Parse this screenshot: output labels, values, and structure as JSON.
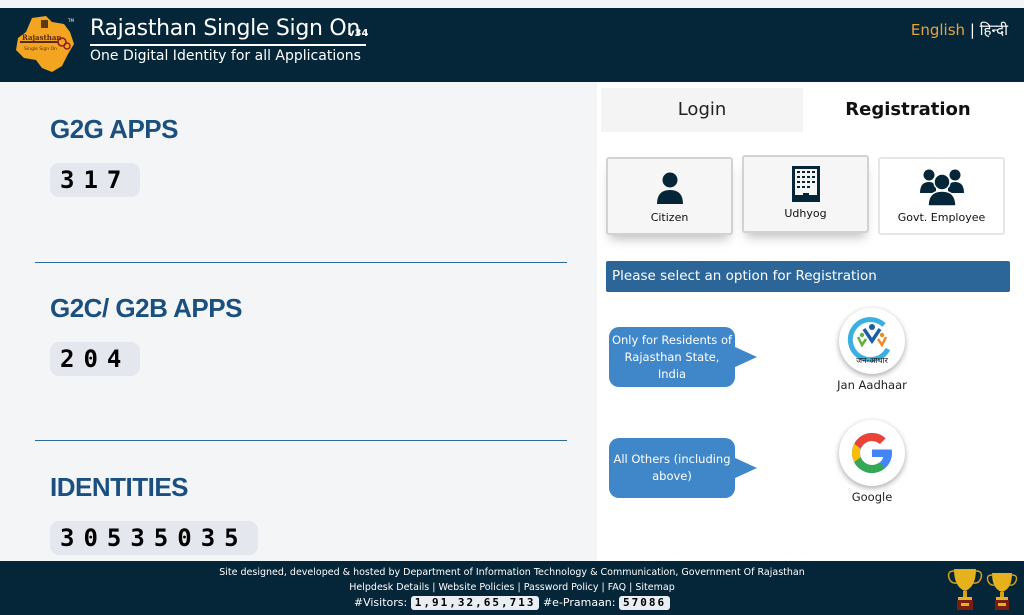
{
  "header": {
    "logo_alt": "Rajasthan Single Sign On",
    "title": "Rajasthan Single Sign On",
    "version": "v34",
    "subtitle": "One Digital Identity for all Applications",
    "lang_english": "English",
    "lang_separator": "|",
    "lang_hindi": "हिन्दी"
  },
  "stats": [
    {
      "label": "G2G APPS",
      "value": "317"
    },
    {
      "label": "G2C/ G2B APPS",
      "value": "204"
    },
    {
      "label": "IDENTITIES",
      "value": "30535035"
    }
  ],
  "tabs": {
    "login": "Login",
    "registration": "Registration",
    "active": "registration"
  },
  "registration": {
    "types": [
      {
        "label": "Citizen",
        "icon": "user-icon"
      },
      {
        "label": "Udhyog",
        "icon": "building-icon"
      },
      {
        "label": "Govt. Employee",
        "icon": "users-icon"
      }
    ],
    "banner": "Please select an option for Registration",
    "options": [
      {
        "note": "Only for Residents of Rajasthan State, India",
        "provider": "Jan Aadhaar",
        "logo_text": "जन-आधार"
      },
      {
        "note": "All Others (including above)",
        "provider": "Google"
      }
    ]
  },
  "footer": {
    "credit": "Site designed, developed & hosted by Department of Information Technology & Communication, Government Of Rajasthan",
    "links": [
      "Helpdesk Details",
      "Website Policies",
      "Password Policy",
      "FAQ",
      "Sitemap"
    ],
    "visitors_label": "#Visitors:",
    "visitors_value": "1,91,32,65,713",
    "epramaan_label": "#e-Pramaan:",
    "epramaan_value": "57086"
  },
  "colors": {
    "header_bg": "#052639",
    "accent_lang": "#e8a33d",
    "stat_heading": "#1a4f80",
    "banner_bg": "#2c6699",
    "bubble_bg": "#3f87c8"
  }
}
